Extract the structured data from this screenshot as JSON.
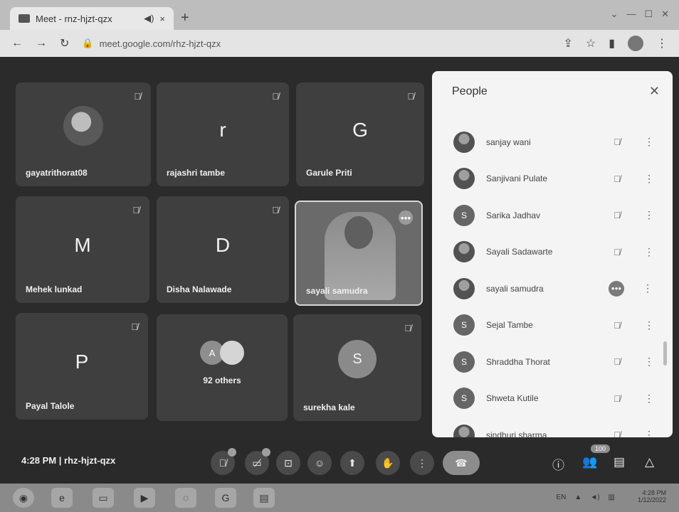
{
  "browser": {
    "tab_title": "Meet - rnz-hjzt-qzx",
    "tab_audio_icon": "speaker-icon",
    "tab_close": "×",
    "new_tab": "+",
    "url": "meet.google.com/rhz-hjzt-qzx"
  },
  "tiles": [
    {
      "name": "gayatrithorat08",
      "kind": "photo"
    },
    {
      "name": "rajashri tambe",
      "kind": "letter",
      "letter": "r"
    },
    {
      "name": "Garule Priti",
      "kind": "letter",
      "letter": "G"
    },
    {
      "name": "Mehek lunkad",
      "kind": "letter",
      "letter": "M"
    },
    {
      "name": "Disha Nalawade",
      "kind": "letter",
      "letter": "D"
    },
    {
      "name": "sayali samudra",
      "kind": "video"
    },
    {
      "name": "Payal Talole",
      "kind": "letter",
      "letter": "P"
    },
    {
      "name": "92 others",
      "kind": "others",
      "avatar_letter": "A"
    },
    {
      "name": "surekha kale",
      "kind": "circle",
      "letter": "S"
    }
  ],
  "people_panel": {
    "title": "People",
    "people": [
      {
        "name": "sanjay wani",
        "avatar": "photo",
        "mic": "muted"
      },
      {
        "name": "Sanjivani Pulate",
        "avatar": "photo",
        "mic": "muted"
      },
      {
        "name": "Sarika Jadhav",
        "avatar": "S",
        "mic": "muted"
      },
      {
        "name": "Sayali Sadawarte",
        "avatar": "photo",
        "mic": "muted"
      },
      {
        "name": "sayali samudra",
        "avatar": "photo",
        "mic": "speaking"
      },
      {
        "name": "Sejal Tambe",
        "avatar": "S",
        "mic": "muted"
      },
      {
        "name": "Shraddha Thorat",
        "avatar": "S",
        "mic": "muted"
      },
      {
        "name": "Shweta Kutile",
        "avatar": "S",
        "mic": "muted"
      },
      {
        "name": "sindhuri sharma",
        "avatar": "photo",
        "mic": "muted"
      }
    ]
  },
  "bottom_bar": {
    "time": "4:28 PM",
    "separator": "|",
    "meeting_code": "rhz-hjzt-qzx",
    "participant_count": "100"
  },
  "taskbar": {
    "lang": "EN",
    "clock_time": "4:28 PM",
    "clock_date": "1/12/2022"
  }
}
